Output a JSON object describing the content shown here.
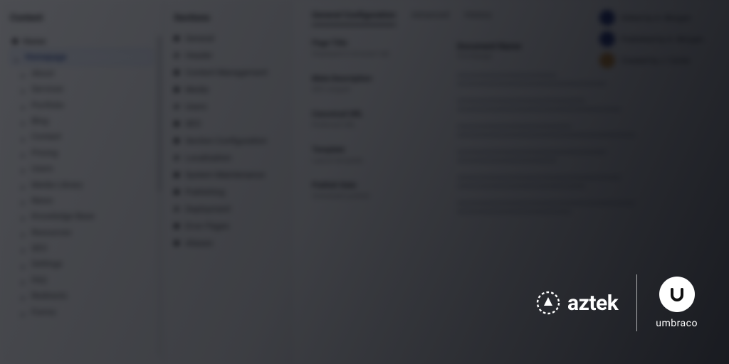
{
  "panels": {
    "content_title": "Content",
    "sections_title": "Sections"
  },
  "tree": {
    "root": "Home",
    "selected": "Homepage",
    "items": [
      "About",
      "Services",
      "Portfolio",
      "Blog",
      "Contact",
      "Pricing",
      "Users",
      "Media Library",
      "News",
      "Knowledge Base",
      "Resources",
      "SEO",
      "Settings",
      "FAQ",
      "Redirects",
      "Forms"
    ]
  },
  "sections": {
    "items": [
      "General",
      "Header",
      "Content Management",
      "Media",
      "Users",
      "SEO",
      "Section Configuration",
      "Localization",
      "System Maintenance",
      "Publishing",
      "Deployment",
      "Error Pages",
      "Aliases"
    ]
  },
  "main": {
    "tabs": [
      "General Configuration",
      "Advanced",
      "History"
    ],
    "title_label": "Document Name",
    "title_value": "Homepage",
    "fields": [
      {
        "label": "Page Title",
        "sub": "Displayed in browser tab"
      },
      {
        "label": "Meta Description",
        "sub": "SEO snippet"
      },
      {
        "label": "Canonical URL",
        "sub": "Preferred URL"
      },
      {
        "label": "Template",
        "sub": "Layout template"
      },
      {
        "label": "Publish Date",
        "sub": "Scheduled publish"
      }
    ]
  },
  "activity": [
    "Edited by A. Morgan",
    "Published by A. Morgan",
    "Created by J. Carter"
  ],
  "branding": {
    "aztek": "aztek",
    "umbraco": "umbraco"
  },
  "colors": {
    "accent": "#1c2f82"
  }
}
